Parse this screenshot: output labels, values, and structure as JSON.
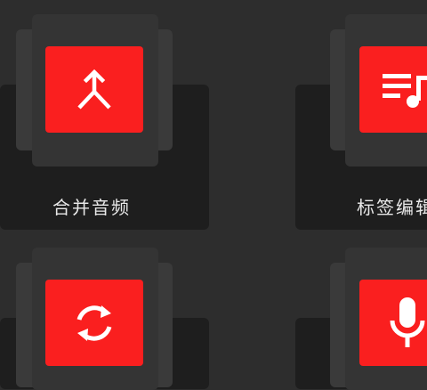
{
  "colors": {
    "background": "#2d2d2d",
    "card": "#1e1e1e",
    "accent": "#fa1f1f",
    "label": "#e8e8e8"
  },
  "grid": [
    {
      "label": "合并音频",
      "icon": "merge-icon"
    },
    {
      "label": "标签编辑",
      "icon": "playlist-music-icon"
    },
    {
      "label": "",
      "icon": "sync-convert-icon"
    },
    {
      "label": "",
      "icon": "microphone-icon"
    }
  ]
}
